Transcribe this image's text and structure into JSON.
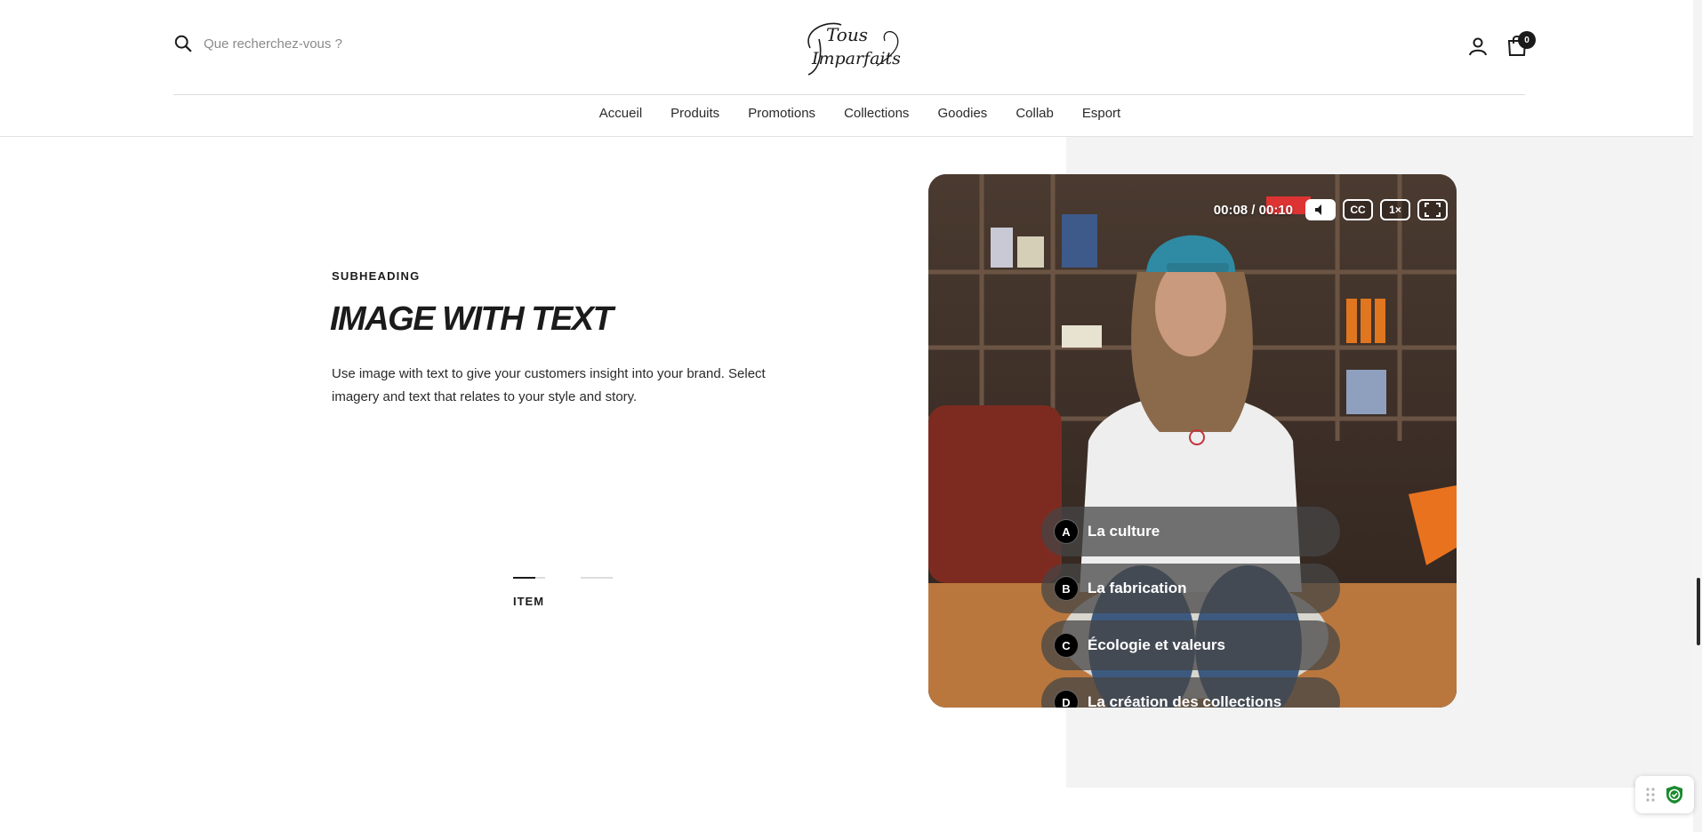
{
  "header": {
    "search": {
      "placeholder": "Que recherchez-vous ?"
    },
    "logo": {
      "text_line1": "Tous",
      "text_line2": "Imparfaits"
    },
    "cart": {
      "count": "0"
    }
  },
  "nav": {
    "items": [
      {
        "label": "Accueil"
      },
      {
        "label": "Produits"
      },
      {
        "label": "Promotions"
      },
      {
        "label": "Collections"
      },
      {
        "label": "Goodies"
      },
      {
        "label": "Collab"
      },
      {
        "label": "Esport"
      }
    ]
  },
  "section": {
    "subheading": "SUBHEADING",
    "title": "IMAGE WITH TEXT",
    "body": "Use image with text to give your customers insight into your brand. Select imagery and text that relates to your style and story.",
    "slider": {
      "active_index": 0,
      "count": 2,
      "item_label": "ITEM",
      "active_progress": 0.7
    }
  },
  "video": {
    "time": "00:08 / 00:10",
    "controls": {
      "cc": "CC",
      "speed": "1×"
    },
    "choices": [
      {
        "letter": "A",
        "text": "La culture"
      },
      {
        "letter": "B",
        "text": "La fabrication"
      },
      {
        "letter": "C",
        "text": "Écologie et valeurs"
      },
      {
        "letter": "D",
        "text": "La création des collections"
      }
    ]
  },
  "colors": {
    "text": "#1c1b1b",
    "gray_block": "#f3f3f3",
    "badge": "#1c1b1b",
    "shield": "#1a8a2e"
  }
}
